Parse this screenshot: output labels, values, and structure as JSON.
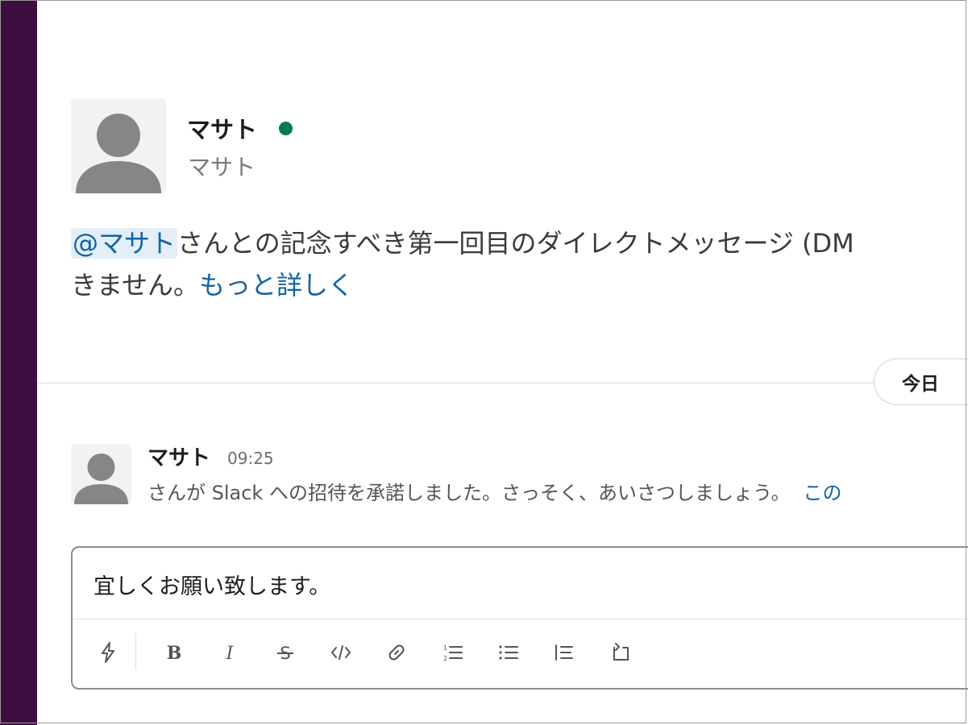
{
  "profile": {
    "name": "マサト",
    "display_name": "マサト",
    "presence": "online"
  },
  "intro": {
    "mention": "@マサト",
    "text_line1": "さんとの記念すべき第一回目のダイレクトメッセージ (DM",
    "text_line2": "きません。",
    "link": "もっと詳しく"
  },
  "divider": {
    "date_label": "今日"
  },
  "message": {
    "author": "マサト",
    "time": "09:25",
    "body": "さんが Slack への招待を承諾しました。さっそく、あいさつしましょう。",
    "link": "この"
  },
  "composer": {
    "text": "宜しくお願い致します。",
    "toolbar": [
      "shortcuts-icon",
      "bold-icon",
      "italic-icon",
      "strikethrough-icon",
      "code-icon",
      "link-icon",
      "ordered-list-icon",
      "bulleted-list-icon",
      "blockquote-icon",
      "code-block-icon"
    ]
  },
  "colors": {
    "sidebar": "#3f0e40",
    "presence": "#007a5a",
    "link": "#1264a3"
  }
}
